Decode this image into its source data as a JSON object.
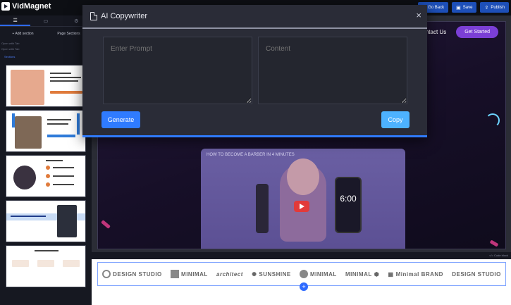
{
  "app": {
    "name": "VidMagnet"
  },
  "topbar": {
    "actions": [
      {
        "label": "Go Back",
        "icon": "back-icon"
      },
      {
        "label": "Save",
        "icon": "save-icon"
      },
      {
        "label": "Publish",
        "icon": "publish-icon"
      }
    ]
  },
  "sidebar": {
    "add_section_label": "+ Add section",
    "page_sections_label": "Page Sections",
    "small_text_1": "Open with Tab",
    "small_text_2": "Open with Tab",
    "sections_title": "Sections"
  },
  "hero": {
    "nav_link": "Contact Us",
    "nav_cta": "Get Started",
    "video_title": "HOW TO BECOME A BARBER IN 4 MINUTES",
    "phone_time": "6:00"
  },
  "strip": {
    "text": "</> Code block"
  },
  "logos": [
    "DESIGN STUDIO",
    "MINIMAL",
    "architect",
    "SUNSHINE",
    "MINIMAL",
    "MINIMAL",
    "Minimal BRAND",
    "DESIGN STUDIO"
  ],
  "modal": {
    "title": "AI Copywriter",
    "close": "×",
    "prompt_placeholder": "Enter Prompt",
    "content_placeholder": "Content",
    "generate_label": "Generate",
    "copy_label": "Copy"
  }
}
